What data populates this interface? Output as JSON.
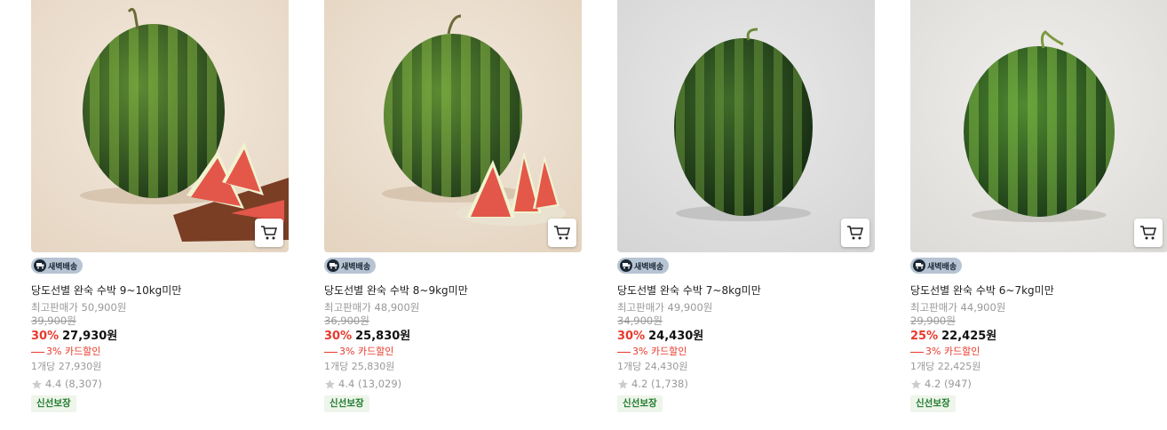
{
  "products": [
    {
      "badge": "새벽배송",
      "name": "당도선별 완숙 수박 9~10kg미만",
      "lowest_price": "최고판매가 50,900원",
      "original_price": "39,900원",
      "discount_rate": "30%",
      "price": "27,930원",
      "card_discount": "3% 카드할인",
      "unit_price": "1개당 27,930원",
      "rating": "4.4 (8,307)",
      "tag": "신선보장"
    },
    {
      "badge": "새벽배송",
      "name": "당도선별 완숙 수박 8~9kg미만",
      "lowest_price": "최고판매가 48,900원",
      "original_price": "36,900원",
      "discount_rate": "30%",
      "price": "25,830원",
      "card_discount": "3% 카드할인",
      "unit_price": "1개당 25,830원",
      "rating": "4.4 (13,029)",
      "tag": "신선보장"
    },
    {
      "badge": "새벽배송",
      "name": "당도선별 완숙 수박 7~8kg미만",
      "lowest_price": "최고판매가 49,900원",
      "original_price": "34,900원",
      "discount_rate": "30%",
      "price": "24,430원",
      "card_discount": "3% 카드할인",
      "unit_price": "1개당 24,430원",
      "rating": "4.2 (1,738)",
      "tag": "신선보장"
    },
    {
      "badge": "새벽배송",
      "name": "당도선별 완숙 수박 6~7kg미만",
      "lowest_price": "최고판매가 44,900원",
      "original_price": "29,900원",
      "discount_rate": "25%",
      "price": "22,425원",
      "card_discount": "3% 카드할인",
      "unit_price": "1개당 22,425원",
      "rating": "4.2 (947)",
      "tag": "신선보장"
    }
  ],
  "colors": {
    "discount_red": "#e8392b",
    "badge_bg": "#b6c4d3",
    "fresh_green": "#1e7a2c",
    "muted_text": "#999999"
  },
  "icons": {
    "cart": "cart-icon",
    "badge": "delivery-truck-icon",
    "star": "star-icon"
  }
}
